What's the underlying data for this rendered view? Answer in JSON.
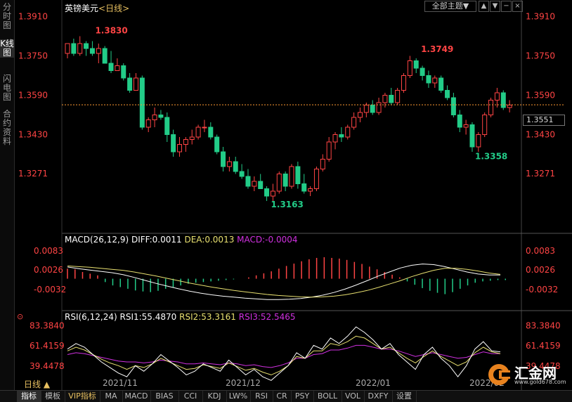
{
  "sidebar": {
    "tabs": [
      {
        "label": "分时图"
      },
      {
        "label": "K线图"
      },
      {
        "label": "闪电图"
      },
      {
        "label": "合约资料"
      }
    ]
  },
  "header": {
    "symbol": "英镑美元",
    "period": "<日线>",
    "theme_label": "全部主题▼"
  },
  "macd": {
    "label": "MACD(26,12,9)",
    "diff": "DIFF:0.0011",
    "dea": "DEA:0.0013",
    "macd": "MACD:-0.0004"
  },
  "rsi": {
    "label": "RSI(6,12,24)",
    "rsi1": "RSI1:55.4870",
    "rsi2": "RSI2:53.3161",
    "rsi3": "RSI3:52.5465"
  },
  "price": {
    "last": "1.3551",
    "high_label": "1.3830",
    "high2_label": "1.3749",
    "low_label": "1.3163",
    "low2_label": "1.3358"
  },
  "period_button": "日线 ▲",
  "bottom_tabs": [
    "指标",
    "模板",
    "VIP指标",
    "MA",
    "MACD",
    "BIAS",
    "CCI",
    "KDJ",
    "LW%",
    "RSI",
    "CR",
    "PSY",
    "BOLL",
    "VOL",
    "DXFY",
    "设置"
  ],
  "logo": {
    "text": "汇金网",
    "url": "www.gold678.com"
  },
  "colors": {
    "up": "#ff4444",
    "down": "#22cc88",
    "diff": "#ffffff",
    "dea": "#e8e070",
    "rsi3": "#d030e0",
    "last_line": "#ff9933"
  },
  "chart_data": {
    "type": "candlestick",
    "y_ticks": [
      "1.3910",
      "1.3750",
      "1.3590",
      "1.3430",
      "1.3271"
    ],
    "x_ticks": [
      "2021/11",
      "2021/12",
      "2022/01",
      "2022/02"
    ],
    "ylim": [
      1.312,
      1.392
    ],
    "candles": [
      [
        1.376,
        1.38,
        1.374,
        1.38
      ],
      [
        1.38,
        1.382,
        1.375,
        1.376
      ],
      [
        1.376,
        1.383,
        1.375,
        1.38
      ],
      [
        1.38,
        1.381,
        1.375,
        1.378
      ],
      [
        1.378,
        1.381,
        1.375,
        1.376
      ],
      [
        1.376,
        1.38,
        1.372,
        1.378
      ],
      [
        1.378,
        1.379,
        1.372,
        1.372
      ],
      [
        1.372,
        1.377,
        1.368,
        1.369
      ],
      [
        1.369,
        1.374,
        1.369,
        1.371
      ],
      [
        1.371,
        1.372,
        1.365,
        1.366
      ],
      [
        1.366,
        1.368,
        1.36,
        1.361
      ],
      [
        1.361,
        1.368,
        1.361,
        1.366
      ],
      [
        1.366,
        1.367,
        1.345,
        1.346
      ],
      [
        1.346,
        1.35,
        1.344,
        1.349
      ],
      [
        1.349,
        1.354,
        1.346,
        1.351
      ],
      [
        1.351,
        1.353,
        1.349,
        1.35
      ],
      [
        1.35,
        1.352,
        1.34,
        1.343
      ],
      [
        1.343,
        1.345,
        1.334,
        1.336
      ],
      [
        1.336,
        1.342,
        1.334,
        1.339
      ],
      [
        1.339,
        1.342,
        1.336,
        1.341
      ],
      [
        1.341,
        1.345,
        1.339,
        1.342
      ],
      [
        1.342,
        1.347,
        1.341,
        1.346
      ],
      [
        1.346,
        1.349,
        1.344,
        1.346
      ],
      [
        1.346,
        1.348,
        1.341,
        1.342
      ],
      [
        1.342,
        1.343,
        1.335,
        1.336
      ],
      [
        1.336,
        1.338,
        1.328,
        1.33
      ],
      [
        1.33,
        1.334,
        1.328,
        1.332
      ],
      [
        1.332,
        1.334,
        1.327,
        1.328
      ],
      [
        1.328,
        1.331,
        1.325,
        1.326
      ],
      [
        1.326,
        1.329,
        1.321,
        1.322
      ],
      [
        1.322,
        1.326,
        1.32,
        1.324
      ],
      [
        1.324,
        1.327,
        1.321,
        1.321
      ],
      [
        1.321,
        1.322,
        1.316,
        1.318
      ],
      [
        1.318,
        1.323,
        1.316,
        1.32
      ],
      [
        1.32,
        1.328,
        1.319,
        1.327
      ],
      [
        1.327,
        1.328,
        1.32,
        1.322
      ],
      [
        1.322,
        1.331,
        1.321,
        1.33
      ],
      [
        1.33,
        1.332,
        1.321,
        1.323
      ],
      [
        1.323,
        1.327,
        1.319,
        1.32
      ],
      [
        1.32,
        1.322,
        1.318,
        1.321
      ],
      [
        1.321,
        1.33,
        1.32,
        1.329
      ],
      [
        1.329,
        1.335,
        1.328,
        1.333
      ],
      [
        1.333,
        1.342,
        1.332,
        1.34
      ],
      [
        1.34,
        1.344,
        1.337,
        1.343
      ],
      [
        1.343,
        1.346,
        1.34,
        1.342
      ],
      [
        1.342,
        1.347,
        1.341,
        1.346
      ],
      [
        1.346,
        1.352,
        1.345,
        1.35
      ],
      [
        1.35,
        1.354,
        1.348,
        1.352
      ],
      [
        1.352,
        1.356,
        1.35,
        1.355
      ],
      [
        1.355,
        1.357,
        1.351,
        1.352
      ],
      [
        1.352,
        1.358,
        1.351,
        1.356
      ],
      [
        1.356,
        1.36,
        1.354,
        1.359
      ],
      [
        1.359,
        1.362,
        1.355,
        1.356
      ],
      [
        1.356,
        1.362,
        1.355,
        1.361
      ],
      [
        1.361,
        1.368,
        1.36,
        1.367
      ],
      [
        1.367,
        1.375,
        1.366,
        1.373
      ],
      [
        1.373,
        1.374,
        1.368,
        1.37
      ],
      [
        1.37,
        1.371,
        1.365,
        1.367
      ],
      [
        1.367,
        1.369,
        1.362,
        1.364
      ],
      [
        1.364,
        1.367,
        1.362,
        1.366
      ],
      [
        1.366,
        1.367,
        1.36,
        1.361
      ],
      [
        1.361,
        1.363,
        1.357,
        1.358
      ],
      [
        1.358,
        1.36,
        1.35,
        1.351
      ],
      [
        1.351,
        1.353,
        1.344,
        1.346
      ],
      [
        1.346,
        1.349,
        1.343,
        1.347
      ],
      [
        1.347,
        1.348,
        1.336,
        1.338
      ],
      [
        1.338,
        1.344,
        1.336,
        1.343
      ],
      [
        1.343,
        1.352,
        1.342,
        1.351
      ],
      [
        1.351,
        1.358,
        1.35,
        1.357
      ],
      [
        1.357,
        1.362,
        1.354,
        1.36
      ],
      [
        1.36,
        1.361,
        1.353,
        1.354
      ],
      [
        1.354,
        1.357,
        1.352,
        1.355
      ]
    ],
    "macd": {
      "ylim": [
        -0.007,
        0.0108
      ],
      "y_ticks": [
        "0.0083",
        "0.0026",
        "-0.0032"
      ],
      "diff": [
        0.0035,
        0.003,
        0.0026,
        0.0022,
        0.0018,
        0.0012,
        0.0004,
        -0.0005,
        -0.0014,
        -0.0022,
        -0.003,
        -0.0037,
        -0.0043,
        -0.0048,
        -0.0052,
        -0.0055,
        -0.0058,
        -0.006,
        -0.0062,
        -0.0062,
        -0.0061,
        -0.0059,
        -0.0055,
        -0.0049,
        -0.0041,
        -0.0031,
        -0.0019,
        -0.0006,
        0.0008,
        0.002,
        0.0032,
        0.004,
        0.0044,
        0.0042,
        0.0036,
        0.0028,
        0.002,
        0.0014,
        0.0011,
        0.0011
      ],
      "dea": [
        0.0038,
        0.0036,
        0.0034,
        0.0031,
        0.0028,
        0.0025,
        0.002,
        0.0014,
        0.0008,
        0.0001,
        -0.0006,
        -0.0013,
        -0.0019,
        -0.0025,
        -0.003,
        -0.0035,
        -0.0039,
        -0.0043,
        -0.0047,
        -0.005,
        -0.0052,
        -0.0054,
        -0.0055,
        -0.0054,
        -0.0052,
        -0.0048,
        -0.0042,
        -0.0035,
        -0.0026,
        -0.0016,
        -0.0006,
        0.0006,
        0.0016,
        0.0025,
        0.0031,
        0.0031,
        0.0028,
        0.0023,
        0.0017,
        0.0013
      ],
      "hist": [
        0.003,
        0.0028,
        0.002,
        0.0015,
        0.001,
        -0.001,
        -0.002,
        -0.0025,
        -0.003,
        -0.0035,
        -0.0038,
        -0.004,
        -0.0036,
        -0.003,
        -0.0025,
        -0.002,
        -0.0015,
        -0.0012,
        -0.001,
        -0.0008,
        -0.0006,
        -0.0004,
        -0.0002,
        0.0,
        0.0004,
        0.001,
        0.0016,
        0.0022,
        0.003,
        0.0038,
        0.0045,
        0.0052,
        0.0058,
        0.0062,
        0.0064,
        0.0062,
        0.006,
        0.0056,
        0.005,
        0.0044,
        0.0036,
        0.0028,
        0.002,
        0.0012,
        0.0004,
        -0.0008,
        -0.0018,
        -0.0028,
        -0.0036,
        -0.0042,
        -0.0046,
        -0.004,
        -0.003,
        -0.002,
        -0.0012,
        -0.0008,
        -0.0006,
        -0.0004,
        -0.0004
      ]
    },
    "rsi": {
      "ylim": [
        25,
        92
      ],
      "y_ticks": [
        "83.3840",
        "61.4159",
        "39.4478"
      ],
      "rsi1": [
        58,
        64,
        60,
        52,
        44,
        38,
        32,
        28,
        40,
        34,
        42,
        52,
        45,
        38,
        30,
        34,
        42,
        38,
        34,
        46,
        38,
        30,
        36,
        28,
        24,
        32,
        40,
        54,
        48,
        62,
        58,
        70,
        64,
        72,
        82,
        76,
        68,
        58,
        64,
        52,
        44,
        36,
        52,
        60,
        48,
        40,
        28,
        40,
        58,
        66,
        56,
        55
      ],
      "rsi2": [
        56,
        60,
        57,
        52,
        47,
        43,
        40,
        36,
        40,
        38,
        42,
        48,
        44,
        40,
        36,
        37,
        41,
        39,
        37,
        43,
        39,
        35,
        37,
        33,
        30,
        34,
        40,
        50,
        48,
        56,
        56,
        64,
        62,
        66,
        72,
        70,
        64,
        58,
        60,
        54,
        48,
        43,
        50,
        56,
        50,
        45,
        40,
        44,
        54,
        60,
        55,
        53
      ],
      "rsi3": [
        52,
        54,
        53,
        51,
        49,
        47,
        45,
        44,
        44,
        43,
        44,
        46,
        45,
        44,
        42,
        42,
        43,
        42,
        41,
        43,
        42,
        40,
        41,
        39,
        38,
        40,
        43,
        48,
        48,
        52,
        53,
        57,
        57,
        59,
        62,
        62,
        60,
        58,
        58,
        56,
        53,
        50,
        52,
        54,
        52,
        50,
        48,
        49,
        52,
        55,
        53,
        53
      ]
    }
  }
}
